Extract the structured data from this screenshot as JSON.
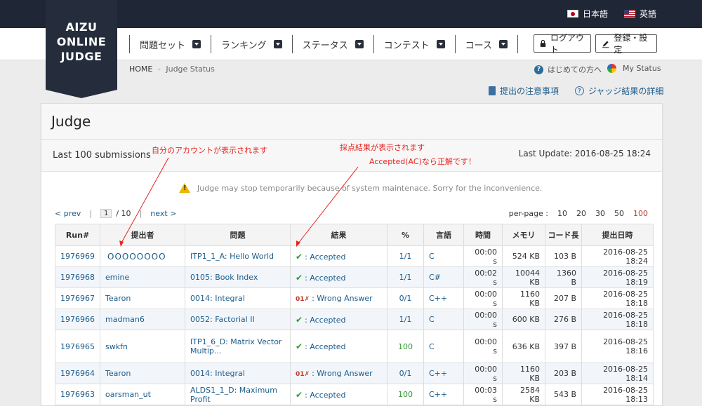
{
  "logo": {
    "line1": "AIZU",
    "line2": "ONLINE",
    "line3": "JUDGE"
  },
  "header": {
    "lang_ja": "日本語",
    "lang_en": "英語"
  },
  "nav": {
    "items": [
      "問題セット",
      "ランキング",
      "ステータス",
      "コンテスト",
      "コース"
    ],
    "logout": "ログアウト",
    "settings": "登録・設定"
  },
  "breadcrumb": {
    "home": "HOME",
    "separator": "-",
    "current": "Judge Status"
  },
  "help": {
    "first_time": "はじめての方へ",
    "my_status": "My Status",
    "submit_notes": "提出の注意事項",
    "judge_details": "ジャッジ結果の詳細"
  },
  "panel": {
    "title": "Judge",
    "subtitle": "Last 100 submissions",
    "last_update": "Last Update: 2016-08-25 18:24"
  },
  "notice": "Judge may stop temporarily because of system maintenace. Sorry for the inconvenience.",
  "pagination": {
    "prev": "< prev",
    "page": "1",
    "total": "/ 10",
    "next": "next >",
    "per_page_label": "per-page :",
    "per_page_options": [
      "10",
      "20",
      "30",
      "50",
      "100"
    ],
    "per_page_active": "100"
  },
  "table": {
    "headers": [
      "Run#",
      "提出者",
      "問題",
      "結果",
      "%",
      "言語",
      "時間",
      "メモリ",
      "コード長",
      "提出日時"
    ],
    "rows": [
      {
        "run": "1976969",
        "user": "OOOOOOOO",
        "problem": "ITP1_1_A: Hello World",
        "status": "Accepted",
        "pct": "1/1",
        "lang": "C",
        "time": "00:00 s",
        "mem": "524 KB",
        "len": "103 B",
        "date": "2016-08-25 18:24"
      },
      {
        "run": "1976968",
        "user": "emine",
        "problem": "0105: Book Index",
        "status": "Accepted",
        "pct": "1/1",
        "lang": "C#",
        "time": "00:02 s",
        "mem": "10044 KB",
        "len": "1360 B",
        "date": "2016-08-25 18:19"
      },
      {
        "run": "1976967",
        "user": "Tearon",
        "problem": "0014: Integral",
        "status": "Wrong Answer",
        "pct": "0/1",
        "lang": "C++",
        "time": "00:00 s",
        "mem": "1160 KB",
        "len": "207 B",
        "date": "2016-08-25 18:18"
      },
      {
        "run": "1976966",
        "user": "madman6",
        "problem": "0052: Factorial II",
        "status": "Accepted",
        "pct": "1/1",
        "lang": "C",
        "time": "00:00 s",
        "mem": "600 KB",
        "len": "276 B",
        "date": "2016-08-25 18:18"
      },
      {
        "run": "1976965",
        "user": "swkfn",
        "problem_line1": "ITP1_6_D: Matrix Vector",
        "problem_line2": "Multip...",
        "status": "Accepted",
        "pct": "100",
        "lang": "C",
        "time": "00:00 s",
        "mem": "636 KB",
        "len": "397 B",
        "date": "2016-08-25 18:16"
      },
      {
        "run": "1976964",
        "user": "Tearon",
        "problem": "0014: Integral",
        "status": "Wrong Answer",
        "pct": "0/1",
        "lang": "C++",
        "time": "00:00 s",
        "mem": "1160 KB",
        "len": "203 B",
        "date": "2016-08-25 18:14"
      },
      {
        "run": "1976963",
        "user": "oarsman_ut",
        "problem": "ALDS1_1_D: Maximum Profit",
        "status": "Accepted",
        "pct": "100",
        "lang": "C++",
        "time": "00:03 s",
        "mem": "2584 KB",
        "len": "543 B",
        "date": "2016-08-25 18:13"
      }
    ]
  },
  "annotations": {
    "account": "自分のアカウントが表示されます",
    "result1": "採点結果が表示されます",
    "result2": "Accepted(AC)なら正解です！"
  },
  "colors": {
    "header_bg": "#1f2736",
    "logo_bg": "#252d3c",
    "link": "#1a5b8c",
    "accepted": "#2e9b2e",
    "annotation": "#e8231f"
  },
  "icons": [
    "flag-japan-icon",
    "flag-us-icon",
    "lock-icon",
    "pencil-icon",
    "question-icon",
    "pie-chart-icon",
    "document-icon",
    "warning-icon",
    "check-icon",
    "wrong-answer-icon"
  ]
}
